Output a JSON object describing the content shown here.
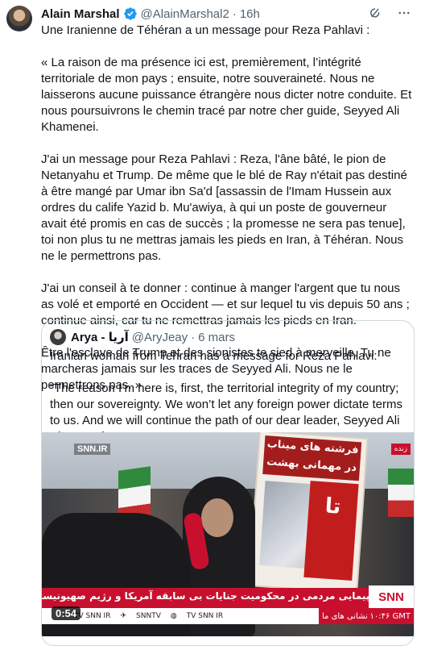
{
  "tweet": {
    "author_name": "Alain Marshal",
    "handle": "@AlainMarshal2",
    "separator": "·",
    "time": "16h",
    "text": "Une Iranienne de Téhéran a un message pour Reza Pahlavi :\n\n« La raison de ma présence ici est, premièrement, l’intégrité territoriale de mon pays ; ensuite, notre souveraineté. Nous ne laisserons aucune puissance étrangère nous dicter notre conduite. Et nous poursuivrons le chemin tracé par notre cher guide, Seyyed Ali Khamenei.\n\nJ'ai un message pour Reza Pahlavi : Reza, l'âne bâté, le pion de Netanyahu et Trump. De même que le blé de Ray n'était pas destiné à être mangé par Umar ibn Sa'd [assassin de l'Imam Hussein aux ordres du calife Yazid b. Mu'awiya, à qui un poste de gouverneur avait été promis en cas de succès ; la promesse ne sera pas tenue], toi non plus tu ne mettras jamais les pieds en Iran, à Téhéran. Nous ne le permettrons pas.\n\nJ'ai un conseil à te donner : continue à manger l'argent que tu nous as volé et emporté en Occident — et sur lequel tu vis depuis 50 ans ; continue ainsi, car tu ne remettras jamais les pieds en Iran.\n\nÊtre l'esclave de Trump et des sionistes te sied à merveille. Tu ne marcheras jamais sur les traces de Seyyed Ali. Nous ne le permettrons pas. »"
  },
  "quote": {
    "author_name": "Arya - آریا",
    "handle": "@AryJeay",
    "separator": "·",
    "time": "6 mars",
    "text": "Iranian woman from Tehran has a message for Reza Pahlavi:\n\n“The reason I’m here is, first, the territorial integrity of my country; then our sovereignty. We won’t let any foreign power dictate terms to us. And we will continue the path of our dear leader, Seyyed Ali Khamenei...."
  },
  "video": {
    "duration": "0:54",
    "channel_logo": "SNN.IR",
    "corner_tag": "زنده",
    "sign_title": "فرشته های میناب در مهمانی بهشت",
    "sign_strip": "تا",
    "headline": "راهپیمایی مردمی در محکومیت جنایات بی سابقه آمریکا و رژیم صهیونیستی",
    "snn_badge": "SNN",
    "social_tv_snn": "TV SNN IR",
    "social_snntv": "SNNTV",
    "social_web": "TV SNN IR",
    "news_label": "نشانی های ما",
    "clock": "۱۰:۴۶ GMT"
  },
  "colors": {
    "verified_blue": "#1d9bf0",
    "secondary_text": "#536471",
    "news_red": "#c8102e"
  },
  "icons": [
    "verified-badge-icon",
    "grok-icon",
    "more-icon",
    "telegram-icon",
    "globe-icon"
  ]
}
